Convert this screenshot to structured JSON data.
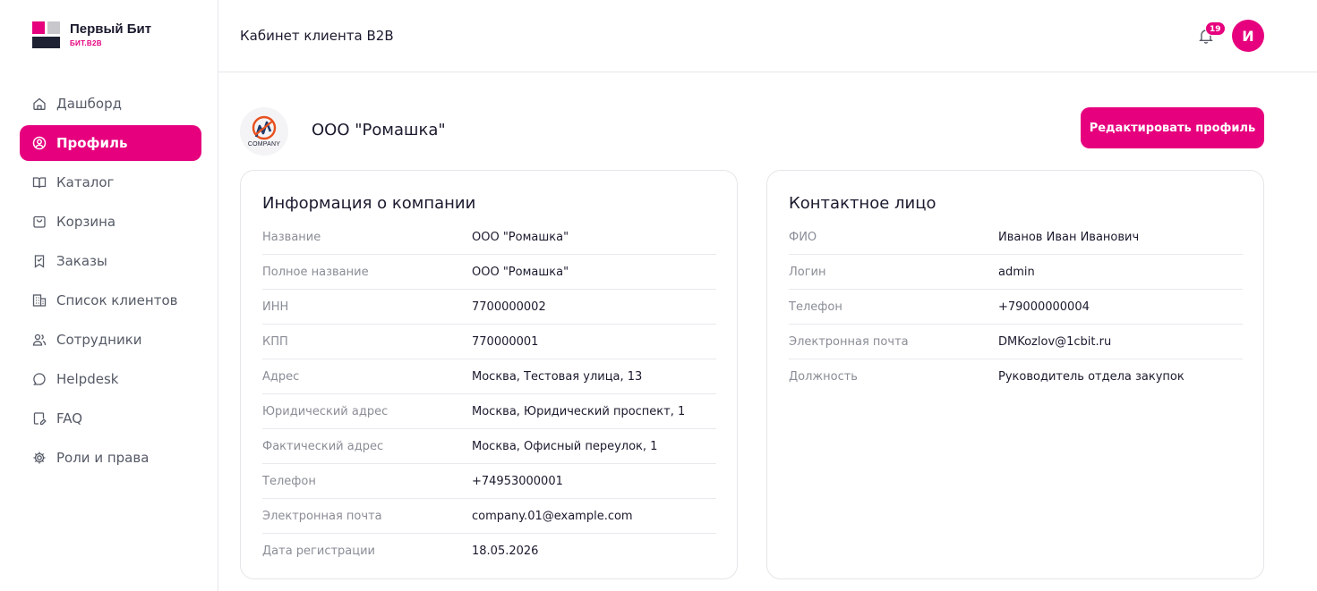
{
  "brand": {
    "title": "Первый Бит",
    "subtitle": "БИТ.B2B"
  },
  "nav": [
    {
      "label": "Дашборд",
      "icon": "home-icon",
      "active": false
    },
    {
      "label": "Профиль",
      "icon": "user-circle-icon",
      "active": true
    },
    {
      "label": "Каталог",
      "icon": "book-open-icon",
      "active": false
    },
    {
      "label": "Корзина",
      "icon": "bag-icon",
      "active": false
    },
    {
      "label": "Заказы",
      "icon": "bookmark-icon",
      "active": false
    },
    {
      "label": "Список клиентов",
      "icon": "building-icon",
      "active": false
    },
    {
      "label": "Сотрудники",
      "icon": "users-icon",
      "active": false
    },
    {
      "label": "Helpdesk",
      "icon": "chat-bubble-icon",
      "active": false
    },
    {
      "label": "FAQ",
      "icon": "document-edit-icon",
      "active": false
    },
    {
      "label": "Роли и права",
      "icon": "gear-icon",
      "active": false
    }
  ],
  "header": {
    "title": "Кабинет клиента B2B",
    "notifications_count": "19",
    "avatar_initial": "И"
  },
  "company": {
    "logo_text": "COMPANY",
    "name": "ООО \"Ромашка\"",
    "edit_label": "Редактировать профиль"
  },
  "company_info": {
    "title": "Информация о компании",
    "rows": [
      {
        "label": "Название",
        "value": "ООО \"Ромашка\""
      },
      {
        "label": "Полное название",
        "value": "ООО \"Ромашка\""
      },
      {
        "label": "ИНН",
        "value": "7700000002"
      },
      {
        "label": "КПП",
        "value": "770000001"
      },
      {
        "label": "Адрес",
        "value": "Москва, Тестовая улица, 13"
      },
      {
        "label": "Юридический адрес",
        "value": "Москва, Юридический проспект, 1"
      },
      {
        "label": "Фактический адрес",
        "value": "Москва, Офисный переулок, 1"
      },
      {
        "label": "Телефон",
        "value": "+74953000001"
      },
      {
        "label": "Электронная почта",
        "value": "company.01@example.com"
      },
      {
        "label": "Дата регистрации",
        "value": "18.05.2026"
      }
    ]
  },
  "contact": {
    "title": "Контактное лицо",
    "rows": [
      {
        "label": "ФИО",
        "value": "Иванов Иван Иванович"
      },
      {
        "label": "Логин",
        "value": "admin"
      },
      {
        "label": "Телефон",
        "value": "+79000000004"
      },
      {
        "label": "Электронная почта",
        "value": "DMKozlov@1cbit.ru"
      },
      {
        "label": "Должность",
        "value": "Руководитель отдела закупок"
      }
    ]
  },
  "colors": {
    "accent": "#e6007e",
    "text": "#1a1a2e",
    "muted": "#8a8d96",
    "border": "#e6e6ea"
  }
}
